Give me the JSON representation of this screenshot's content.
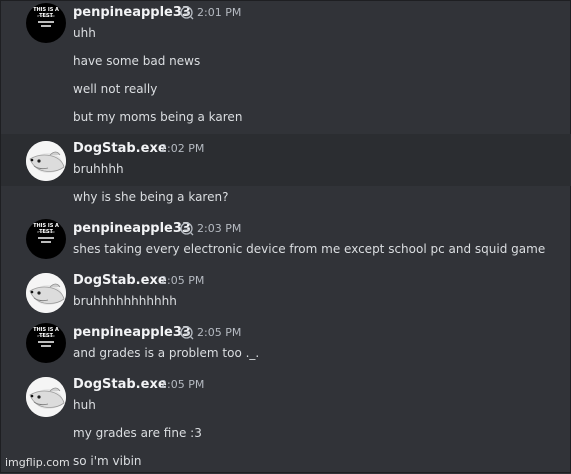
{
  "messages": [
    {
      "author": "penpineapple33",
      "time": "2:01 PM",
      "lines": [
        "uhh",
        "have some bad news",
        "well not really",
        "but my moms being a karen"
      ]
    },
    {
      "author": "DogStab.exe",
      "time": "2:02 PM",
      "lines": [
        "bruhhhh",
        "why is she being a karen?"
      ]
    },
    {
      "author": "penpineapple33",
      "time": "2:03 PM",
      "lines": [
        "shes taking every electronic device from me except school pc and squid game"
      ]
    },
    {
      "author": "DogStab.exe",
      "time": "2:05 PM",
      "lines": [
        "bruhhhhhhhhhhh"
      ]
    },
    {
      "author": "penpineapple33",
      "time": "2:05 PM",
      "lines": [
        "and grades is a problem too ._."
      ]
    },
    {
      "author": "DogStab.exe",
      "time": "2:05 PM",
      "lines": [
        "huh",
        "my grades are fine :3",
        "so i'm vibin"
      ]
    }
  ],
  "avatar_text": {
    "line1": "THIS IS A TEST",
    "line2": "IF YOU CAN"
  },
  "watermark": "imgflip.com",
  "icons": {
    "badge": "speech-bubble-icon"
  },
  "colors": {
    "background": "#313338",
    "hover": "#2b2d31",
    "name": "#f2f3f5",
    "text": "#dbdee1",
    "timestamp": "#b5bac1"
  }
}
